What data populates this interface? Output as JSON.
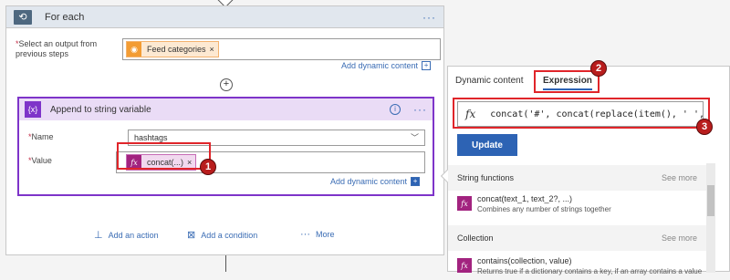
{
  "foreach": {
    "title": "For each",
    "menu": "···",
    "select_label": "Select an output from previous steps",
    "token": "Feed categories",
    "token_close": "×",
    "add_dynamic": "Add dynamic content",
    "add_step": "+"
  },
  "append": {
    "icon_label": "{x}",
    "title": "Append to string variable",
    "info": "i",
    "menu": "···",
    "name_label": "Name",
    "name_value": "hashtags",
    "value_label": "Value",
    "value_token": "concat(...)",
    "token_close": "×",
    "add_dynamic": "Add dynamic content"
  },
  "footer": {
    "add_action": "Add an action",
    "add_condition": "Add a condition",
    "more": "More"
  },
  "panel": {
    "tab_dynamic": "Dynamic content",
    "tab_expression": "Expression",
    "expression_text": "concat('#', concat(replace(item(), ' ', '",
    "update": "Update",
    "section1": "String functions",
    "section1_more": "See more",
    "func1_name": "concat(text_1, text_2?, ...)",
    "func1_desc": "Combines any number of strings together",
    "section2": "Collection",
    "section2_more": "See more",
    "func2_name": "contains(collection, value)",
    "func2_desc": "Returns true if a dictionary contains a key, if an array contains a value"
  },
  "callouts": [
    "1",
    "2",
    "3"
  ],
  "colors": {
    "accent": "#2d63b4",
    "variable_purple": "#7e34c9",
    "expression_magenta": "#a2237f",
    "rss_orange": "#f39c33",
    "highlight_red": "#e0252a"
  }
}
